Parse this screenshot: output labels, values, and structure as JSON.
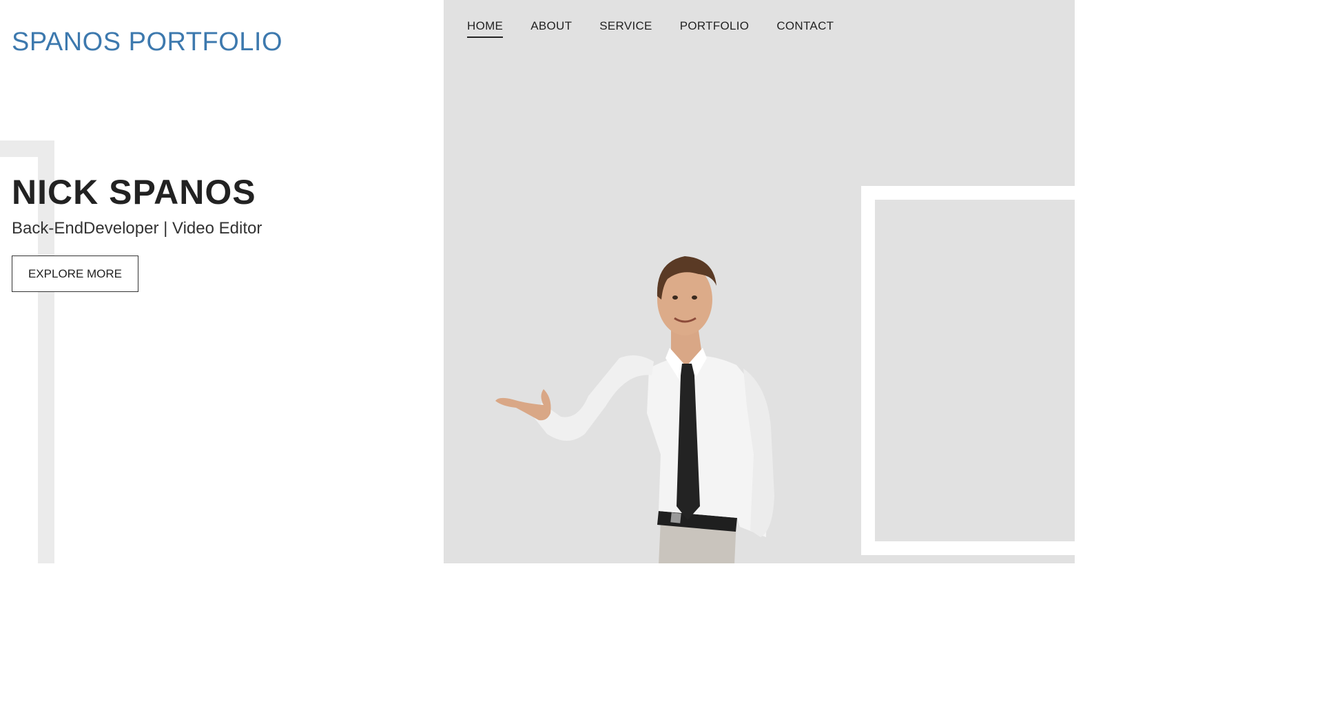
{
  "header": {
    "logo": "SPANOS PORTFOLIO"
  },
  "nav": {
    "items": [
      {
        "label": "HOME",
        "active": true
      },
      {
        "label": "ABOUT",
        "active": false
      },
      {
        "label": "SERVICE",
        "active": false
      },
      {
        "label": "PORTFOLIO",
        "active": false
      },
      {
        "label": "CONTACT",
        "active": false
      }
    ]
  },
  "hero": {
    "name": "NICK SPANOS",
    "subtitle": "Back-EndDeveloper | Video Editor",
    "cta_label": "EXPLORE MORE",
    "image_name": "man-in-white-shirt-pointing"
  },
  "colors": {
    "logo": "#3d79ae",
    "panel_bg": "#e1e1e1",
    "frame": "#ffffff",
    "deco": "#ebebeb",
    "text": "#222222"
  }
}
